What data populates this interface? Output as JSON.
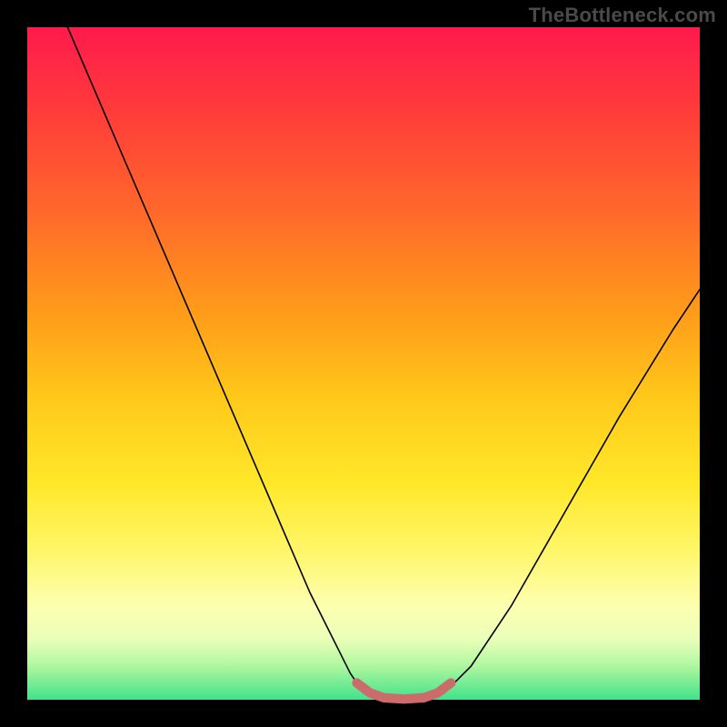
{
  "watermark": "TheBottleneck.com",
  "chart_data": {
    "type": "line",
    "title": "",
    "xlabel": "",
    "ylabel": "",
    "xlim": [
      0,
      100
    ],
    "ylim": [
      0,
      100
    ],
    "grid": false,
    "legend": false,
    "background_gradient": {
      "top": "#ff1a4d",
      "mid": "#ffe82a",
      "bottom": "#41e28a"
    },
    "series": [
      {
        "name": "bottleneck-curve",
        "stroke": "#000000",
        "points": [
          {
            "x": 6,
            "y": 100
          },
          {
            "x": 12,
            "y": 86
          },
          {
            "x": 18,
            "y": 72
          },
          {
            "x": 24,
            "y": 58
          },
          {
            "x": 30,
            "y": 44
          },
          {
            "x": 36,
            "y": 30
          },
          {
            "x": 42,
            "y": 16
          },
          {
            "x": 48,
            "y": 4
          },
          {
            "x": 50,
            "y": 1
          },
          {
            "x": 53,
            "y": 0
          },
          {
            "x": 58,
            "y": 0
          },
          {
            "x": 62,
            "y": 1
          },
          {
            "x": 66,
            "y": 5
          },
          {
            "x": 72,
            "y": 14
          },
          {
            "x": 80,
            "y": 28
          },
          {
            "x": 88,
            "y": 42
          },
          {
            "x": 96,
            "y": 55
          },
          {
            "x": 100,
            "y": 61
          }
        ]
      },
      {
        "name": "optimal-band",
        "stroke": "#cc6b6b",
        "stroke_width": 10,
        "points": [
          {
            "x": 49,
            "y": 2.5
          },
          {
            "x": 51,
            "y": 1
          },
          {
            "x": 53,
            "y": 0.3
          },
          {
            "x": 56,
            "y": 0.1
          },
          {
            "x": 59,
            "y": 0.3
          },
          {
            "x": 61,
            "y": 1
          },
          {
            "x": 63,
            "y": 2.5
          }
        ]
      }
    ]
  }
}
